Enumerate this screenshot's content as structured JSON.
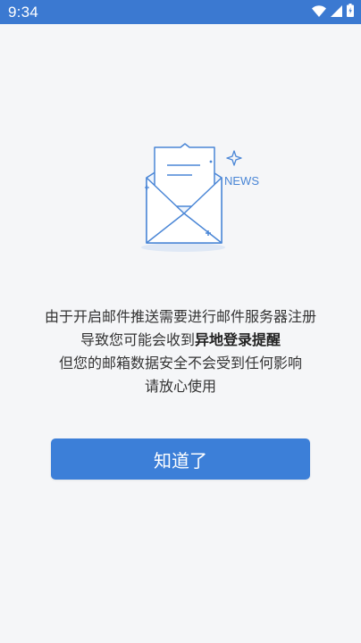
{
  "status_bar": {
    "time": "9:34",
    "icons": [
      "wifi-icon",
      "cellular-signal-icon",
      "battery-icon"
    ]
  },
  "illustration": {
    "news_label": "NEWS"
  },
  "message": {
    "line1": "由于开启邮件推送需要进行邮件服务器注册",
    "line2_prefix": "导致您可能会收到",
    "line2_bold": "异地登录提醒",
    "line3": "但您的邮箱数据安全不会受到任何影响",
    "line4": "请放心使用"
  },
  "button": {
    "label": "知道了"
  },
  "colors": {
    "status_bar": "#3b79d1",
    "accent": "#3c7fd8",
    "background": "#f5f6f8",
    "illustration_line": "#4a86d6"
  }
}
